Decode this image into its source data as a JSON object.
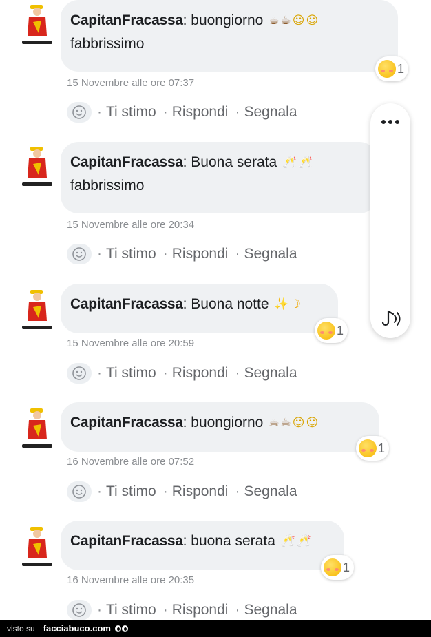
{
  "comments": [
    {
      "author": "CapitanFracassa",
      "separator": ":",
      "text_line1": " buongiorno",
      "emojis_line1": [
        "☕",
        "☕",
        "☺",
        "☺"
      ],
      "text_line2": "fabbrissimo",
      "reaction_count": "1",
      "timestamp": "15 Novembre alle ore 07:37"
    },
    {
      "author": "CapitanFracassa",
      "separator": ":",
      "text_line1": " Buona serata",
      "emojis_line1": [
        "🥂",
        "🥂"
      ],
      "text_line2": "fabbrissimo",
      "reaction_count": "",
      "timestamp": "15 Novembre alle ore 20:34"
    },
    {
      "author": "CapitanFracassa",
      "separator": ":",
      "text_line1": " Buona notte",
      "emojis_line1": [
        "✨",
        "☽"
      ],
      "text_line2": "",
      "reaction_count": "1",
      "timestamp": "15 Novembre alle ore 20:59"
    },
    {
      "author": "CapitanFracassa",
      "separator": ":",
      "text_line1": " buongiorno",
      "emojis_line1": [
        "☕",
        "☕",
        "☺",
        "☺"
      ],
      "text_line2": "",
      "reaction_count": "1",
      "timestamp": "16 Novembre alle ore 07:52"
    },
    {
      "author": "CapitanFracassa",
      "separator": ":",
      "text_line1": " buona serata",
      "emojis_line1": [
        "🥂",
        "🥂"
      ],
      "text_line2": "",
      "reaction_count": "1",
      "timestamp": "16 Novembre alle ore 20:35"
    }
  ],
  "actions": {
    "ti_stimo": "Ti stimo",
    "rispondi": "Rispondi",
    "segnala": "Segnala",
    "sep": "·"
  },
  "side_panel": {
    "more_icon": "more-dots-icon",
    "audio_icon": "text-to-speech-icon"
  },
  "footer": {
    "visto_su": "visto su",
    "brand": "facciabuco.com"
  },
  "colors": {
    "bubble": "#eff1f3",
    "text": "#1c1e21",
    "muted": "#65676b",
    "timestamp": "#8a8d91"
  }
}
